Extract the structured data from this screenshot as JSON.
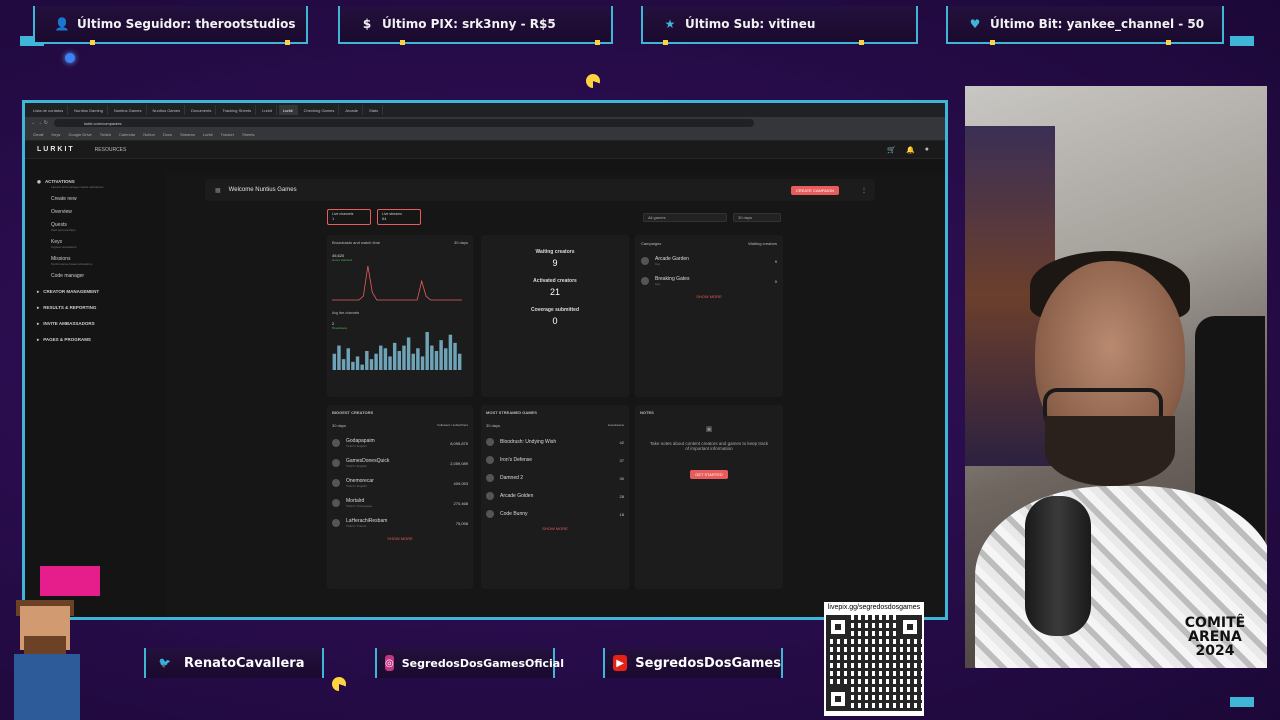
{
  "alerts": [
    {
      "label": "Último Seguidor: therootstudios",
      "icon": "user-icon",
      "color": "#3fb6d8"
    },
    {
      "label": "Último PIX: srk3nny - R$5",
      "icon": "dollar-icon",
      "color": "#3fb6d8"
    },
    {
      "label": "Último Sub: vitineu",
      "icon": "star-icon",
      "color": "#3fb6d8"
    },
    {
      "label": "Último Bit: yankee_channel - 50",
      "icon": "heart-icon",
      "color": "#3fb6d8"
    }
  ],
  "browser": {
    "tabs": [
      "Lista de contatos",
      "Nuntius Gaming",
      "Nuntius Games",
      "Nuntius Games",
      "Documents",
      "Tracking Sheets",
      "Lurkit",
      "Lurkit",
      "Checking Games",
      "Arcade",
      "Stats"
    ],
    "address": "lurkit.com/companies",
    "bookmarks": [
      "Gmail",
      "Keys",
      "Google Drive",
      "Twitch",
      "Calendar",
      "Notion",
      "Docs",
      "Streams",
      "Lurkit",
      "Tracker",
      "Sheets"
    ]
  },
  "app": {
    "logo": "LURKIT",
    "resources": "RESOURCES",
    "sidebar": {
      "activations": "ACTIVATIONS",
      "activations_sub": "Launch and manage creator activations",
      "items": [
        {
          "label": "Create new",
          "sub": ""
        },
        {
          "label": "Overview",
          "sub": ""
        },
        {
          "label": "Quests",
          "sub": "Paid sponsorships"
        },
        {
          "label": "Keys",
          "sub": "Organic activations"
        },
        {
          "label": "Missions",
          "sub": "Performance-based activations"
        },
        {
          "label": "Code manager",
          "sub": ""
        }
      ],
      "sections": [
        "CREATOR MANAGEMENT",
        "RESULTS & REPORTING",
        "INVITE AMBASSADORS",
        "PAGES & PROGRAMS"
      ]
    },
    "welcome": "Welcome Nuntius Games",
    "create_campaign": "CREATE CAMPAIGN",
    "chips": [
      {
        "label": "Live channels",
        "value": "1"
      },
      {
        "label": "Live streams",
        "value": "64"
      }
    ],
    "filters": {
      "games": "All games",
      "range": "30 days"
    },
    "chart_card": {
      "title": "Broadcasts and watch time",
      "range": "30 days",
      "metric1": "45,620",
      "metric1_sub": "Hours watched",
      "metric2_label": "Avg live channels",
      "metric2": "2",
      "metric2_sub": "Broadcasts",
      "spark": [
        0,
        0,
        0,
        0,
        0,
        0,
        0,
        1,
        9,
        2,
        0,
        0,
        0,
        0,
        0,
        0,
        0,
        0,
        0,
        0,
        5,
        1,
        0,
        0,
        0,
        0,
        0,
        0,
        0,
        0
      ],
      "bars": [
        6,
        9,
        4,
        8,
        3,
        5,
        2,
        7,
        4,
        6,
        9,
        8,
        5,
        10,
        7,
        9,
        12,
        6,
        8,
        5,
        14,
        9,
        7,
        11,
        8,
        13,
        10,
        6
      ]
    },
    "stats": [
      {
        "label": "Waiting creators",
        "value": "9"
      },
      {
        "label": "Activated creators",
        "value": "21"
      },
      {
        "label": "Coverage submitted",
        "value": "0"
      }
    ],
    "campaigns": {
      "col1": "Campaigns",
      "col2": "Waiting creators",
      "items": [
        {
          "name": "Arcade Garden",
          "sub": "Key",
          "value": "9"
        },
        {
          "name": "Breaking Gates",
          "sub": "Key",
          "value": "0"
        }
      ],
      "more": "SHOW MORE"
    },
    "creators": {
      "title": "BIGGEST CREATORS",
      "range": "30 days",
      "col": "Followers / subscribers",
      "items": [
        {
          "name": "Godapapaim",
          "sub": "Twitch / English",
          "value": "8,095,875"
        },
        {
          "name": "GamesDonesQuick",
          "sub": "Twitch / English",
          "value": "2,059,089"
        },
        {
          "name": "Onemorecar",
          "sub": "Twitch / English",
          "value": "409,053"
        },
        {
          "name": "Mortalrd",
          "sub": "Twitch / Portuguese",
          "value": "270,468"
        },
        {
          "name": "LaHerachiResbam",
          "sub": "Twitch / French",
          "value": "75,098"
        }
      ],
      "more": "SHOW MORE"
    },
    "games": {
      "title": "MOST STREAMED GAMES",
      "range": "30 days",
      "col": "Livestreams",
      "items": [
        {
          "name": "Bloodrush: Undying Wish",
          "value": "42"
        },
        {
          "name": "Iron's Defense",
          "value": "37"
        },
        {
          "name": "Damned 2",
          "value": "30"
        },
        {
          "name": "Arcade Golden",
          "value": "28"
        },
        {
          "name": "Code Bunny",
          "value": "18"
        }
      ],
      "more": "SHOW MORE"
    },
    "notes": {
      "title": "NOTES",
      "text": "Take notes about content creators and games to keep track of important information",
      "button": "GET STARTED"
    }
  },
  "social": [
    {
      "label": "RenatoCavallera",
      "icon": "twitter-icon",
      "color": "#1da1f2"
    },
    {
      "label": "SegredosDosGamesOficial",
      "icon": "instagram-icon",
      "color": "#c13584"
    },
    {
      "label": "SegredosDosGames",
      "icon": "youtube-icon",
      "color": "#e62117"
    }
  ],
  "qr": {
    "url": "livepix.gg/segredosdosgames"
  },
  "webcam": {
    "badge": "COMITÊ ARENA 2024"
  },
  "colors": {
    "accent": "#3fb6d8",
    "lurkit_red": "#e85c5c",
    "background": "#2a0d4e"
  }
}
